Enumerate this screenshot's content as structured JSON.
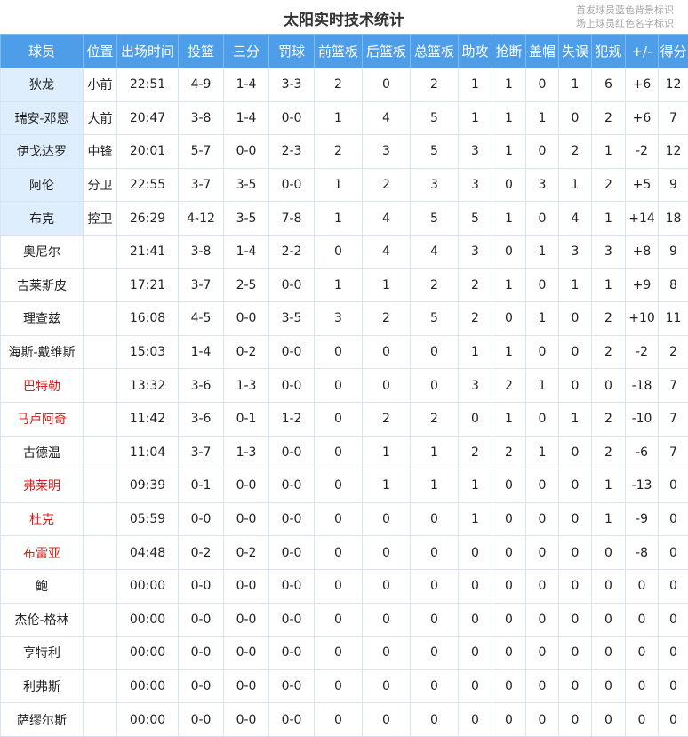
{
  "title": "太阳实时技术统计",
  "legend": [
    "首发球员蓝色背景标识",
    "场上球员红色名字标识"
  ],
  "columns": [
    "球员",
    "位置",
    "出场时间",
    "投篮",
    "三分",
    "罚球",
    "前篮板",
    "后篮板",
    "总篮板",
    "助攻",
    "抢断",
    "盖帽",
    "失误",
    "犯规",
    "+/-",
    "得分"
  ],
  "colors": {
    "header_bg": "#4d9de8",
    "starter_bg": "#dfeefd",
    "oncourt_text": "#e01919"
  },
  "players": [
    {
      "name": "狄龙",
      "starter": true,
      "on_court": false,
      "cells": [
        "小前",
        "22:51",
        "4-9",
        "1-4",
        "3-3",
        "2",
        "0",
        "2",
        "1",
        "1",
        "0",
        "1",
        "6",
        "+6",
        "12"
      ]
    },
    {
      "name": "瑞安-邓恩",
      "starter": true,
      "on_court": false,
      "cells": [
        "大前",
        "20:47",
        "3-8",
        "1-4",
        "0-0",
        "1",
        "4",
        "5",
        "1",
        "1",
        "1",
        "0",
        "2",
        "+6",
        "7"
      ]
    },
    {
      "name": "伊戈达罗",
      "starter": true,
      "on_court": false,
      "cells": [
        "中锋",
        "20:01",
        "5-7",
        "0-0",
        "2-3",
        "2",
        "3",
        "5",
        "3",
        "1",
        "0",
        "2",
        "1",
        "-2",
        "12"
      ]
    },
    {
      "name": "阿伦",
      "starter": true,
      "on_court": false,
      "cells": [
        "分卫",
        "22:55",
        "3-7",
        "3-5",
        "0-0",
        "1",
        "2",
        "3",
        "3",
        "0",
        "3",
        "1",
        "2",
        "+5",
        "9"
      ]
    },
    {
      "name": "布克",
      "starter": true,
      "on_court": false,
      "cells": [
        "控卫",
        "26:29",
        "4-12",
        "3-5",
        "7-8",
        "1",
        "4",
        "5",
        "5",
        "1",
        "0",
        "4",
        "1",
        "+14",
        "18"
      ]
    },
    {
      "name": "奥尼尔",
      "starter": false,
      "on_court": false,
      "cells": [
        "",
        "21:41",
        "3-8",
        "1-4",
        "2-2",
        "0",
        "4",
        "4",
        "3",
        "0",
        "1",
        "3",
        "3",
        "+8",
        "9"
      ]
    },
    {
      "name": "吉莱斯皮",
      "starter": false,
      "on_court": false,
      "cells": [
        "",
        "17:21",
        "3-7",
        "2-5",
        "0-0",
        "1",
        "1",
        "2",
        "2",
        "1",
        "0",
        "1",
        "1",
        "+9",
        "8"
      ]
    },
    {
      "name": "理查兹",
      "starter": false,
      "on_court": false,
      "cells": [
        "",
        "16:08",
        "4-5",
        "0-0",
        "3-5",
        "3",
        "2",
        "5",
        "2",
        "0",
        "1",
        "0",
        "2",
        "+10",
        "11"
      ]
    },
    {
      "name": "海斯-戴维斯",
      "starter": false,
      "on_court": false,
      "cells": [
        "",
        "15:03",
        "1-4",
        "0-2",
        "0-0",
        "0",
        "0",
        "0",
        "1",
        "1",
        "0",
        "0",
        "2",
        "-2",
        "2"
      ]
    },
    {
      "name": "巴特勒",
      "starter": false,
      "on_court": true,
      "cells": [
        "",
        "13:32",
        "3-6",
        "1-3",
        "0-0",
        "0",
        "0",
        "0",
        "3",
        "2",
        "1",
        "0",
        "0",
        "-18",
        "7"
      ]
    },
    {
      "name": "马卢阿奇",
      "starter": false,
      "on_court": true,
      "cells": [
        "",
        "11:42",
        "3-6",
        "0-1",
        "1-2",
        "0",
        "2",
        "2",
        "0",
        "1",
        "0",
        "1",
        "2",
        "-10",
        "7"
      ]
    },
    {
      "name": "古德温",
      "starter": false,
      "on_court": false,
      "cells": [
        "",
        "11:04",
        "3-7",
        "1-3",
        "0-0",
        "0",
        "1",
        "1",
        "2",
        "2",
        "1",
        "0",
        "2",
        "-6",
        "7"
      ]
    },
    {
      "name": "弗莱明",
      "starter": false,
      "on_court": true,
      "cells": [
        "",
        "09:39",
        "0-1",
        "0-0",
        "0-0",
        "0",
        "1",
        "1",
        "1",
        "0",
        "0",
        "0",
        "1",
        "-13",
        "0"
      ]
    },
    {
      "name": "杜克",
      "starter": false,
      "on_court": true,
      "cells": [
        "",
        "05:59",
        "0-0",
        "0-0",
        "0-0",
        "0",
        "0",
        "0",
        "1",
        "0",
        "0",
        "0",
        "1",
        "-9",
        "0"
      ]
    },
    {
      "name": "布雷亚",
      "starter": false,
      "on_court": true,
      "cells": [
        "",
        "04:48",
        "0-2",
        "0-2",
        "0-0",
        "0",
        "0",
        "0",
        "0",
        "0",
        "0",
        "0",
        "0",
        "-8",
        "0"
      ]
    },
    {
      "name": "鲍",
      "starter": false,
      "on_court": false,
      "cells": [
        "",
        "00:00",
        "0-0",
        "0-0",
        "0-0",
        "0",
        "0",
        "0",
        "0",
        "0",
        "0",
        "0",
        "0",
        "0",
        "0"
      ]
    },
    {
      "name": "杰伦-格林",
      "starter": false,
      "on_court": false,
      "cells": [
        "",
        "00:00",
        "0-0",
        "0-0",
        "0-0",
        "0",
        "0",
        "0",
        "0",
        "0",
        "0",
        "0",
        "0",
        "0",
        "0"
      ]
    },
    {
      "name": "亨特利",
      "starter": false,
      "on_court": false,
      "cells": [
        "",
        "00:00",
        "0-0",
        "0-0",
        "0-0",
        "0",
        "0",
        "0",
        "0",
        "0",
        "0",
        "0",
        "0",
        "0",
        "0"
      ]
    },
    {
      "name": "利弗斯",
      "starter": false,
      "on_court": false,
      "cells": [
        "",
        "00:00",
        "0-0",
        "0-0",
        "0-0",
        "0",
        "0",
        "0",
        "0",
        "0",
        "0",
        "0",
        "0",
        "0",
        "0"
      ]
    },
    {
      "name": "萨缪尔斯",
      "starter": false,
      "on_court": false,
      "cells": [
        "",
        "00:00",
        "0-0",
        "0-0",
        "0-0",
        "0",
        "0",
        "0",
        "0",
        "0",
        "0",
        "0",
        "0",
        "0",
        "0"
      ]
    }
  ]
}
